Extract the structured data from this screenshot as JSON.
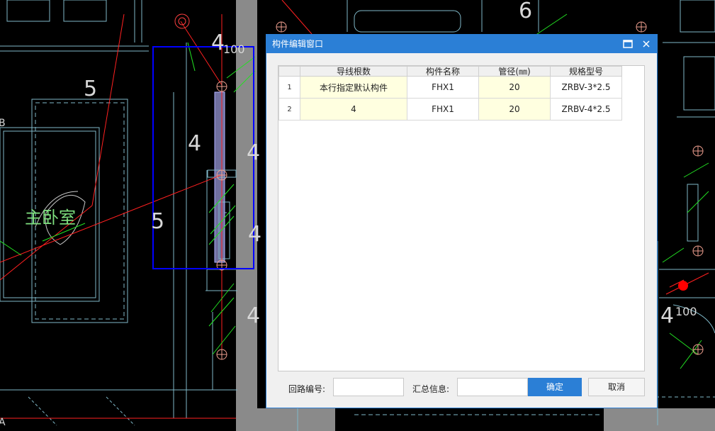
{
  "background": {
    "room_label": "主卧室",
    "numbers": [
      "5",
      "4",
      "4",
      "4",
      "5",
      "4",
      "4",
      "4",
      "6"
    ],
    "dim_labels": [
      "100",
      "100"
    ],
    "edge_letters": [
      "B",
      "A"
    ]
  },
  "dialog": {
    "title": "构件编辑窗口",
    "maximize_icon": "maximize-icon",
    "close_icon": "close-icon",
    "columns": [
      "导线根数",
      "构件名称",
      "管径(㎜)",
      "规格型号"
    ],
    "rows": [
      {
        "index": "1",
        "wire_count": "本行指定默认构件",
        "component_name": "FHX1",
        "pipe_diameter": "20",
        "spec_model": "ZRBV-3*2.5"
      },
      {
        "index": "2",
        "wire_count": "4",
        "component_name": "FHX1",
        "pipe_diameter": "20",
        "spec_model": "ZRBV-4*2.5"
      }
    ],
    "circuit_label": "回路编号:",
    "circuit_value": "",
    "summary_label": "汇总信息:",
    "summary_value": "",
    "ok_label": "确定",
    "cancel_label": "取消"
  },
  "colors": {
    "accent": "#2b7fd6",
    "highlight_cell": "#ffffe0",
    "cad_red": "#ff2020",
    "cad_green": "#22e022",
    "cad_cyan": "#64b4c8",
    "selection": "#0000ff"
  }
}
